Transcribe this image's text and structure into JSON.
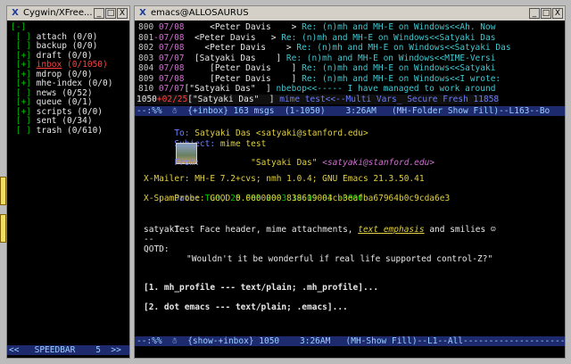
{
  "left_window": {
    "title": "Cygwin/XFree...",
    "folders": [
      {
        "prefix": "[-]",
        "name": "",
        "count": ""
      },
      {
        "prefix": " [ ]",
        "name": "attach",
        "count": "(0/0)"
      },
      {
        "prefix": " [ ]",
        "name": "backup",
        "count": "(0/0)"
      },
      {
        "prefix": " [+]",
        "name": "draft",
        "count": "(0/0)"
      },
      {
        "prefix": " [+]",
        "name": "inbox",
        "count": "(0/1050)"
      },
      {
        "prefix": " [+]",
        "name": "mdrop",
        "count": "(0/0)"
      },
      {
        "prefix": " [+]",
        "name": "mhe-index",
        "count": "(0/0)"
      },
      {
        "prefix": " [ ]",
        "name": "news",
        "count": "(0/52)"
      },
      {
        "prefix": " [+]",
        "name": "queue",
        "count": "(0/1)"
      },
      {
        "prefix": " [+]",
        "name": "scripts",
        "count": "(0/0)"
      },
      {
        "prefix": " [ ]",
        "name": "sent",
        "count": "(0/34)"
      },
      {
        "prefix": " [ ]",
        "name": "trash",
        "count": "(0/610)"
      }
    ],
    "speedbar": "<<   SPEEDBAR    5  >>"
  },
  "emacs_window": {
    "title": "emacs@ALLOSAURUS",
    "messages": [
      {
        "num": "800",
        "flag": " ",
        "date": "07/08",
        "from": "     <Peter Davis    >",
        "subject": "Re: (n)mh and MH-E on Windows<<Ah. Now"
      },
      {
        "num": "801",
        "flag": "-",
        "date": "07/08",
        "from": "  <Peter Davis   >",
        "subject": "Re: (n)mh and MH-E on Windows<<Satyaki Das"
      },
      {
        "num": "802",
        "flag": " ",
        "date": "07/08",
        "from": "    <Peter Davis    >",
        "subject": "Re: (n)mh and MH-E on Windows<<Satyaki Das"
      },
      {
        "num": "803",
        "flag": " ",
        "date": "07/07",
        "from": "  [Satyaki Das    ]",
        "subject": "Re: (n)mh and MH-E on Windows<<MIME-Versi"
      },
      {
        "num": "804",
        "flag": " ",
        "date": "07/08",
        "from": "     [Peter Davis    ]",
        "subject": "Re: (n)mh and MH-E on Windows<<Satyaki"
      },
      {
        "num": "809",
        "flag": " ",
        "date": "07/08",
        "from": "     [Peter Davis    ]",
        "subject": "Re: (n)mh and MH-E on Windows<<I wrote:"
      },
      {
        "num": "810",
        "flag": " ",
        "date": "07/07",
        "from": "[\"Satyaki Das\"  ]",
        "subject": "nbebop<<----- I have managed to work around"
      },
      {
        "num": "1050",
        "flag": "+",
        "date": "02/25",
        "from": "[\"Satyaki Das\"  ]",
        "subject": "mime test<<--Multi Vars_ Secure Fresh 11858"
      }
    ],
    "folder_modeline": "--:%%  ☃  {+inbox} 163 msgs  (1-1050)    3:26AM   (MH-Folder Show Fill)--L163--Bo",
    "headers": {
      "to_label": "To:",
      "to_value": "Satyaki Das <satyaki@stanford.edu>",
      "subject_label": "Subject:",
      "subject_value": "mime test",
      "from_label": "From:",
      "from_name": "\"Satyaki Das\"",
      "from_email": "<satyaki@stanford.edu>",
      "xmailer": "X-Mailer: MH-E 7.2+cvs; nmh 1.0.4; GNU Emacs 21.3.50.41",
      "date_label": "Date:",
      "date_value": "Tue, 25 Feb 2003 19:09 03 -0800",
      "spamprobe": "X-SpamProbe: GOOD 0.0000000 838619004cb3eafba67964b0c9cda6e3"
    },
    "body": {
      "line1_pre": "Test Face header, mime attachments, ",
      "line1_emph": "text emphasis",
      "line1_post": " and smilies ☺",
      "sig1": "satyaki",
      "sig2": "--",
      "quote_label": "QOTD:",
      "quote": "\"Wouldn't it be wonderful if real life supported control-Z?\"",
      "attach1": "[1. mh_profile --- text/plain; .mh_profile]...",
      "attach2": "[2. dot emacs --- text/plain; .emacs]..."
    },
    "show_modeline": "--:%%  ☃  {show-+inbox} 1050    3:26AM   (MH-Show Fill)--L1--All----------------------"
  },
  "buttons": {
    "minimize": "_",
    "maximize": "□",
    "close": "X"
  },
  "icons": {
    "x-logo": "X",
    "snowman": "☃"
  }
}
